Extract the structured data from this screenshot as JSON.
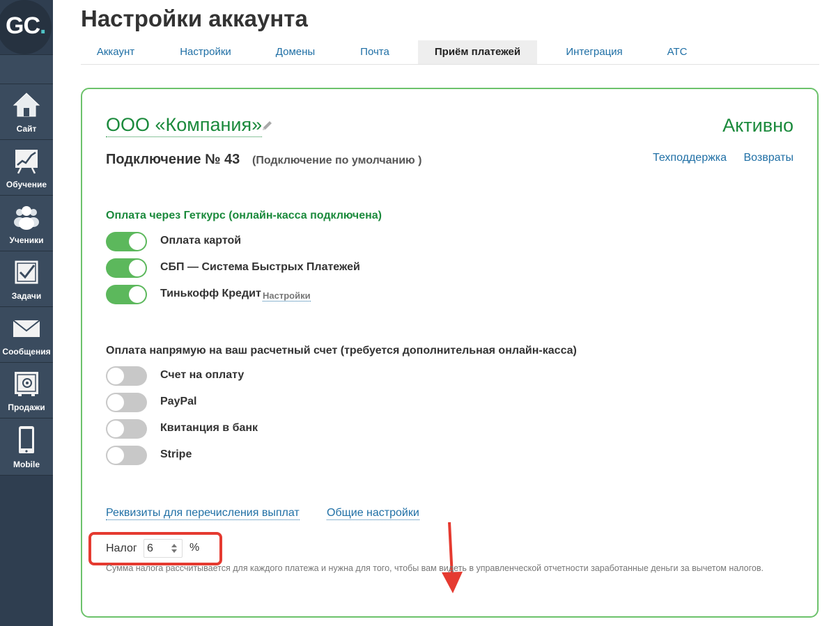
{
  "sidebar": {
    "logo": {
      "text": "GC",
      "dot": "."
    },
    "items": [
      {
        "label": "Сайт",
        "icon": "house-icon"
      },
      {
        "label": "Обучение",
        "icon": "chart-board-icon"
      },
      {
        "label": "Ученики",
        "icon": "users-icon"
      },
      {
        "label": "Задачи",
        "icon": "checkbox-icon"
      },
      {
        "label": "Сообщения",
        "icon": "envelope-icon"
      },
      {
        "label": "Продажи",
        "icon": "safe-icon"
      },
      {
        "label": "Mobile",
        "icon": "phone-icon"
      }
    ]
  },
  "header": {
    "title": "Настройки аккаунта",
    "tabs": [
      {
        "label": "Аккаунт",
        "active": false
      },
      {
        "label": "Настройки",
        "active": false
      },
      {
        "label": "Домены",
        "active": false
      },
      {
        "label": "Почта",
        "active": false
      },
      {
        "label": "Приём платежей",
        "active": true
      },
      {
        "label": "Интеграция",
        "active": false
      },
      {
        "label": "АТС",
        "active": false
      }
    ]
  },
  "card": {
    "company": "ООО «Компания»",
    "status": "Активно",
    "connection_title": "Подключение № 43",
    "connection_subtitle": "(Подключение по умолчанию )",
    "links": {
      "support": "Техподдержка",
      "refunds": "Возвраты"
    },
    "section_getcourse": {
      "title": "Оплата через Геткурс (онлайн-касса подключена)",
      "items": [
        {
          "label": "Оплата картой",
          "enabled": true
        },
        {
          "label": "СБП — Система Быстрых Платежей",
          "enabled": true
        },
        {
          "label": "Тинькофф Кредит",
          "enabled": true,
          "link": "Настройки"
        }
      ]
    },
    "section_direct": {
      "title": "Оплата напрямую на ваш расчетный счет (требуется дополнительная онлайн-касса)",
      "items": [
        {
          "label": "Счет на оплату",
          "enabled": false
        },
        {
          "label": "PayPal",
          "enabled": false
        },
        {
          "label": "Квитанция в банк",
          "enabled": false
        },
        {
          "label": "Stripe",
          "enabled": false
        }
      ]
    },
    "bottom_links": {
      "requisites": "Реквизиты для перечисления выплат",
      "general_settings": "Общие настройки"
    },
    "tax": {
      "label": "Налог",
      "value": "6",
      "unit": "%",
      "hint": "Сумма налога рассчитывается для каждого платежа и нужна для того, чтобы вам видеть в управленческой отчетности заработанные деньги за вычетом налогов."
    }
  },
  "colors": {
    "sidebar": "#3a4b5e",
    "accent_green": "#1b8a3c",
    "toggle_on": "#5cb85c",
    "toggle_off": "#c8c8c8",
    "link": "#1f6fa5",
    "highlight": "#e53a30"
  }
}
